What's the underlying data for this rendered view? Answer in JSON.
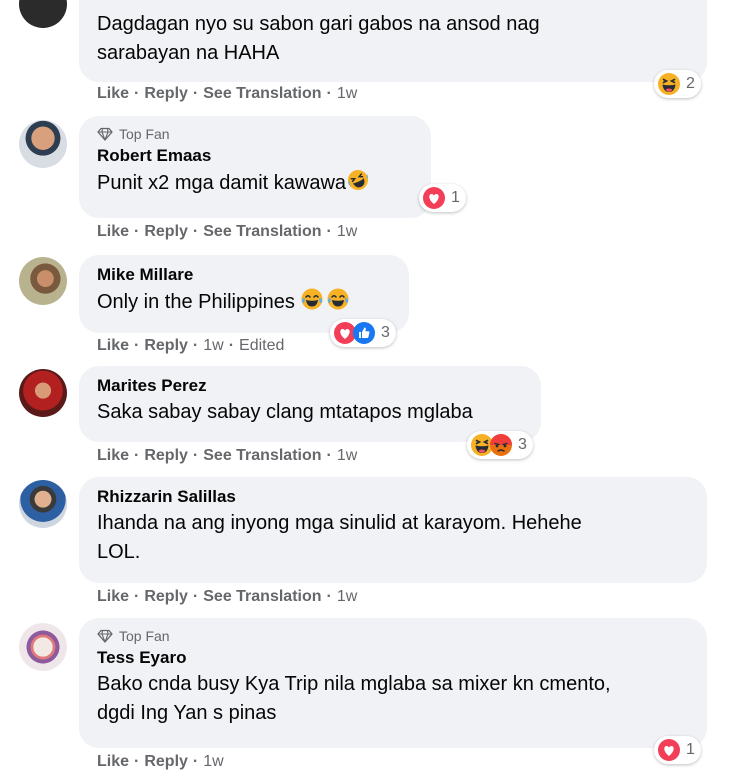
{
  "icons": {
    "top_fan": "diamond-icon",
    "haha": "haha-reaction-icon",
    "love": "love-reaction-icon",
    "like": "like-reaction-icon",
    "angry": "angry-reaction-icon",
    "rofl": "rolling-laughing-emoji"
  },
  "colors": {
    "bubble": "#f0f2f5",
    "action_text": "#65676b",
    "love": "#f33e58",
    "like": "#1877f2",
    "haha": "#f7b125"
  },
  "comments": [
    {
      "text": "Dagdagan nyo su sabon gari gabos na ansod nag\nsarabayan na HAHA",
      "actions": {
        "like": "Like",
        "reply": "Reply",
        "translate": "See Translation",
        "time": "1w"
      },
      "reaction_count": "2"
    },
    {
      "top_fan": "Top Fan",
      "author": "Robert Emaas",
      "text": "Punit x2 mga damit kawawa",
      "actions": {
        "like": "Like",
        "reply": "Reply",
        "translate": "See Translation",
        "time": "1w"
      },
      "reaction_count": "1"
    },
    {
      "author": "Mike Millare",
      "text": "Only in the Philippines ",
      "actions": {
        "like": "Like",
        "reply": "Reply",
        "time": "1w",
        "edited": "Edited"
      },
      "reaction_count": "3"
    },
    {
      "author": "Marites Perez",
      "text": "Saka sabay sabay clang mtatapos mglaba",
      "actions": {
        "like": "Like",
        "reply": "Reply",
        "translate": "See Translation",
        "time": "1w"
      },
      "reaction_count": "3"
    },
    {
      "author": "Rhizzarin Salillas",
      "text": "Ihanda na ang inyong mga sinulid at karayom. Hehehe\nLOL.",
      "actions": {
        "like": "Like",
        "reply": "Reply",
        "translate": "See Translation",
        "time": "1w"
      }
    },
    {
      "top_fan": "Top Fan",
      "author": "Tess Eyaro",
      "text": "Bako cnda busy Kya Trip nila mglaba sa mixer kn cmento,\ndgdi Ing Yan s pinas",
      "actions": {
        "like": "Like",
        "reply": "Reply",
        "time": "1w"
      },
      "reaction_count": "1"
    }
  ]
}
